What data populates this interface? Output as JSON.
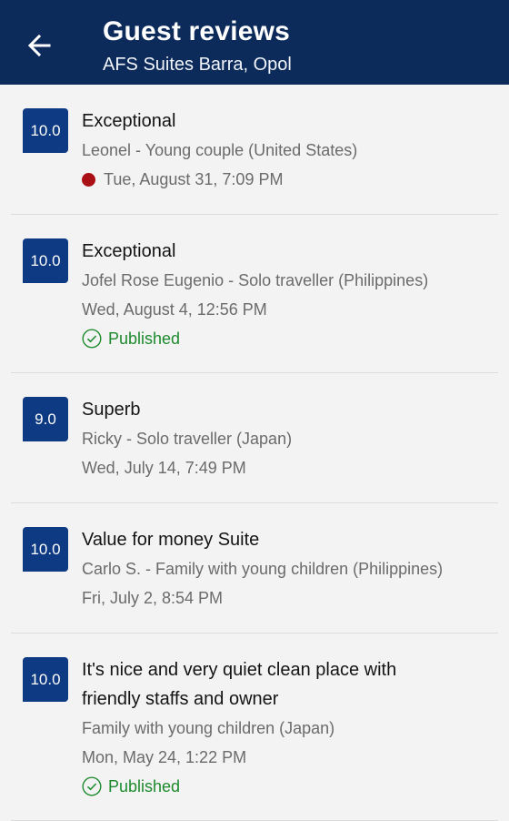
{
  "header": {
    "title": "Guest reviews",
    "subtitle": "AFS Suites Barra, Opol",
    "back_icon": "arrow-left-icon"
  },
  "colors": {
    "header_bg": "#0c2b5b",
    "score_bg": "#0d3a83",
    "published_green": "#1e8a2e",
    "unread_dot": "#a90f14"
  },
  "reviews": [
    {
      "score": "10.0",
      "title": "Exceptional",
      "reviewer": "Leonel - Young couple (United States)",
      "date": "Tue, August 31, 7:09 PM",
      "status": "",
      "unread": true
    },
    {
      "score": "10.0",
      "title": "Exceptional",
      "reviewer": "Jofel Rose Eugenio - Solo traveller (Philippines)",
      "date": "Wed, August 4, 12:56 PM",
      "status": "Published",
      "unread": false
    },
    {
      "score": "9.0",
      "title": "Superb",
      "reviewer": "Ricky - Solo traveller (Japan)",
      "date": "Wed, July 14, 7:49 PM",
      "status": "",
      "unread": false
    },
    {
      "score": "10.0",
      "title": "Value for money Suite",
      "reviewer": "Carlo S. - Family with young children (Philippines)",
      "date": "Fri, July 2, 8:54 PM",
      "status": "",
      "unread": false
    },
    {
      "score": "10.0",
      "title": "It's nice and very quiet clean place with friendly staffs and owner",
      "reviewer": "Family with young children (Japan)",
      "date": "Mon, May 24, 1:22 PM",
      "status": "Published",
      "unread": false
    }
  ]
}
